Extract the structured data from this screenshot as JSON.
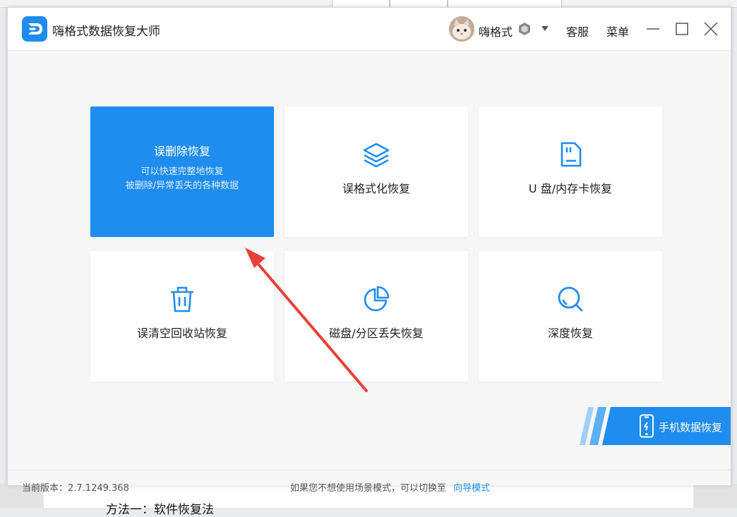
{
  "app": {
    "title": "嗨格式数据恢复大师",
    "user_name": "嗨格式",
    "customer_service": "客服",
    "menu": "菜单",
    "accent_color": "#1f8cf0"
  },
  "cards": [
    {
      "label": "误删除恢复",
      "desc_line1": "可以快速完整地恢复",
      "desc_line2": "被删除/异常丢失的各种数据",
      "icon": "delete-recovery-icon",
      "active": true
    },
    {
      "label": "误格式化恢复",
      "icon": "layers-icon"
    },
    {
      "label": "U 盘/内存卡恢复",
      "icon": "sd-card-icon"
    },
    {
      "label": "误清空回收站恢复",
      "icon": "trash-icon"
    },
    {
      "label": "磁盘/分区丢失恢复",
      "icon": "pie-chart-icon"
    },
    {
      "label": "深度恢复",
      "icon": "search-icon"
    }
  ],
  "mobile_banner": {
    "label": "手机数据恢复",
    "icon": "phone-icon"
  },
  "status": {
    "version": "当前版本：2.7.1249.368",
    "hint": "如果您不想使用场景模式，可以切换至",
    "guide_mode": "向导模式"
  },
  "background": {
    "doc_text": "方法一：软件恢复法"
  }
}
